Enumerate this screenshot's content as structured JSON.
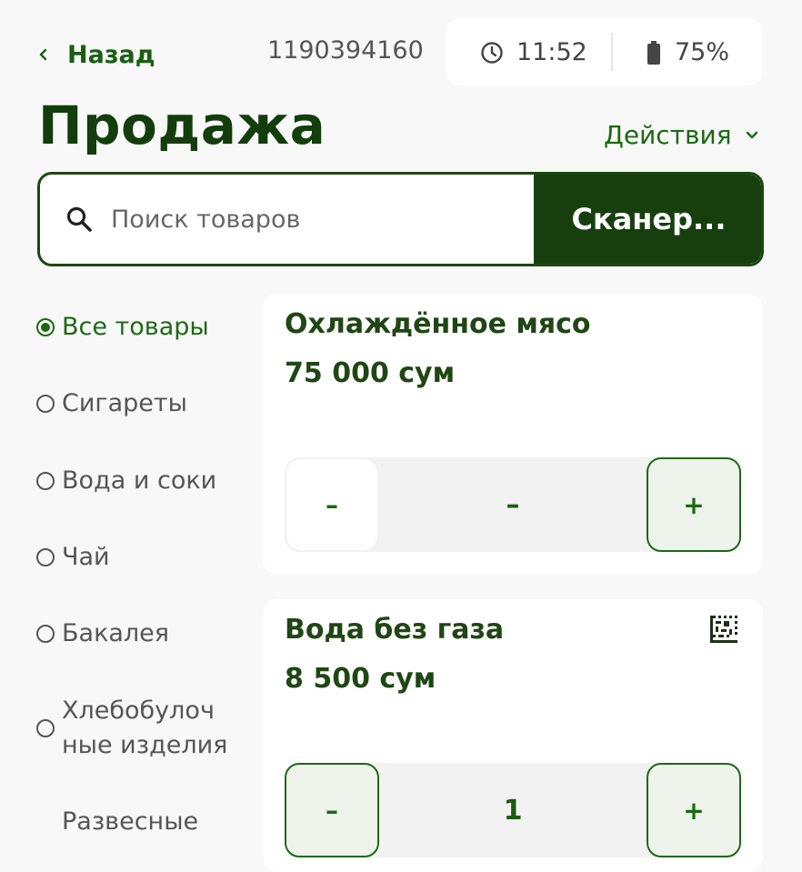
{
  "header": {
    "back_label": "Назад",
    "device_id": "1190394160",
    "time": "11:52",
    "battery": "75%",
    "icons": [
      "chevron-left-icon",
      "clock-icon",
      "battery-icon"
    ]
  },
  "page": {
    "title": "Продажа",
    "actions_label": "Действия"
  },
  "search": {
    "placeholder": "Поиск товаров",
    "value": "",
    "scanner_label": "Сканер..."
  },
  "categories": [
    {
      "label": "Все товары",
      "selected": true
    },
    {
      "label": "Сигареты",
      "selected": false
    },
    {
      "label": "Вода и соки",
      "selected": false
    },
    {
      "label": "Чай",
      "selected": false
    },
    {
      "label": "Бакалея",
      "selected": false
    },
    {
      "label": "Хлебобулоч\nные изделия",
      "selected": false
    },
    {
      "label": "Развесные",
      "selected": false
    }
  ],
  "products": [
    {
      "name": "Охлаждённое мясо",
      "price": "75 000 сум",
      "quantity": "–",
      "minus": "–",
      "plus": "+",
      "has_marking_icon": false
    },
    {
      "name": "Вода без газа",
      "price": "8 500 сум",
      "quantity": "1",
      "minus": "–",
      "plus": "+",
      "has_marking_icon": true
    }
  ],
  "colors": {
    "accent": "#1b6a13",
    "accent_dark": "#173f0e",
    "background": "#f8f8f8",
    "card": "#ffffff"
  }
}
